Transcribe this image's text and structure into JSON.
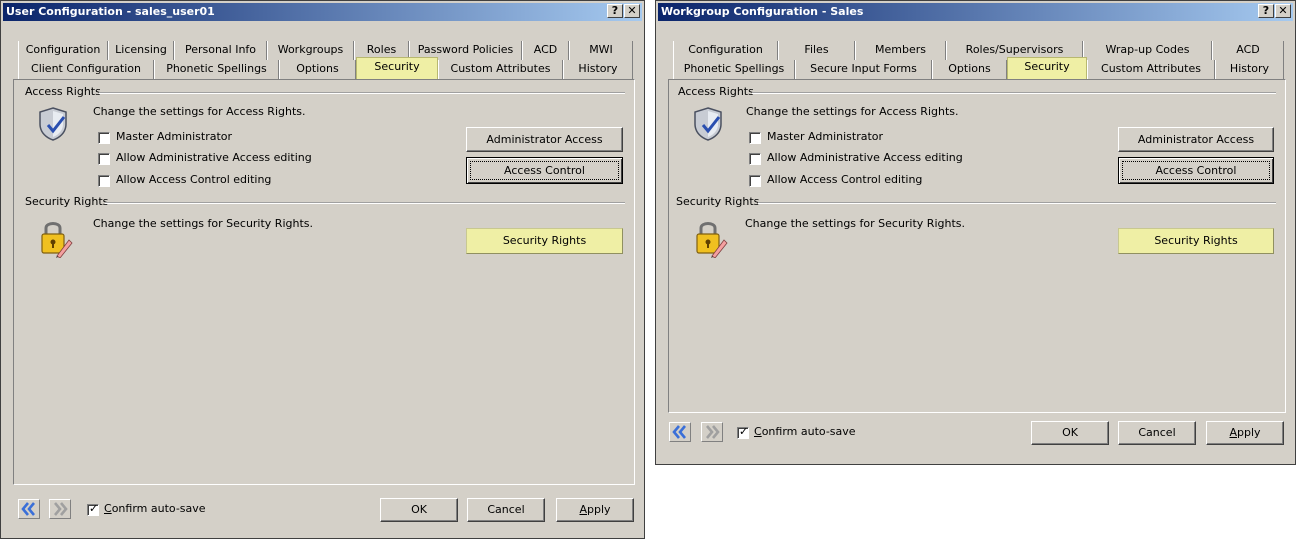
{
  "win1": {
    "title": "User Configuration - sales_user01",
    "help_glyph": "?",
    "close_glyph": "✕",
    "tabs_row1": [
      "Configuration",
      "Licensing",
      "Personal Info",
      "Workgroups",
      "Roles",
      "Password Policies",
      "ACD",
      "MWI"
    ],
    "tabs_row2": [
      "Client Configuration",
      "Phonetic Spellings",
      "Options",
      "Security",
      "Custom Attributes",
      "History"
    ],
    "access_rights": {
      "header": "Access Rights",
      "desc": "Change the settings for Access Rights.",
      "checks": [
        {
          "label": "Master Administrator",
          "checked": false
        },
        {
          "label": "Allow Administrative Access editing",
          "checked": false
        },
        {
          "label": "Allow Access Control editing",
          "checked": false
        }
      ],
      "btn_admin": "Administrator Access",
      "btn_access": "Access Control"
    },
    "security_rights": {
      "header": "Security Rights",
      "desc": "Change the settings for Security Rights.",
      "btn": "Security Rights"
    },
    "footer": {
      "confirm_prefix": "",
      "confirm_u": "C",
      "confirm_rest": "onfirm auto-save",
      "confirm_checked": true,
      "ok": "OK",
      "cancel": "Cancel",
      "apply_u": "A",
      "apply_rest": "pply"
    }
  },
  "win2": {
    "title": "Workgroup Configuration - Sales",
    "help_glyph": "?",
    "close_glyph": "✕",
    "tabs_row1": [
      "Configuration",
      "Files",
      "Members",
      "Roles/Supervisors",
      "Wrap-up Codes",
      "ACD"
    ],
    "tabs_row2": [
      "Phonetic Spellings",
      "Secure Input Forms",
      "Options",
      "Security",
      "Custom Attributes",
      "History"
    ],
    "access_rights": {
      "header": "Access Rights",
      "desc": "Change the settings for Access Rights.",
      "checks": [
        {
          "label": "Master Administrator",
          "checked": false
        },
        {
          "label": "Allow Administrative Access editing",
          "checked": false
        },
        {
          "label": "Allow Access Control editing",
          "checked": false
        }
      ],
      "btn_admin": "Administrator Access",
      "btn_access": "Access Control"
    },
    "security_rights": {
      "header": "Security Rights",
      "desc": "Change the settings for Security Rights.",
      "btn": "Security Rights"
    },
    "footer": {
      "confirm_u": "C",
      "confirm_rest": "onfirm auto-save",
      "confirm_checked": true,
      "ok": "OK",
      "cancel": "Cancel",
      "apply_u": "A",
      "apply_rest": "pply"
    }
  },
  "colors": {
    "selected_tab": "#efefa5",
    "title_gradient_start": "#0a246a",
    "title_gradient_end": "#a6caf0",
    "nav_back_arrow": "#3a6fd8",
    "nav_fwd_arrow": "#a0a0a0"
  },
  "icons": {
    "access": "shield-check-icon",
    "security": "padlock-pencil-icon",
    "nav_back": "double-chevron-left-icon",
    "nav_fwd": "double-chevron-right-icon"
  }
}
